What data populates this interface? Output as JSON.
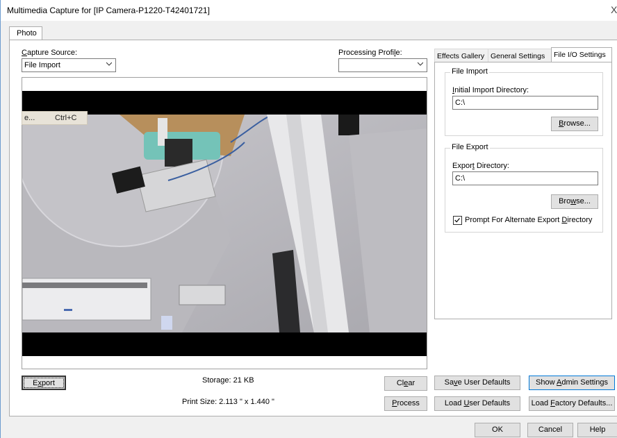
{
  "window": {
    "title": "Multimedia Capture for [IP Camera-P1220-T42401721]",
    "close_glyph": "X"
  },
  "tabs": {
    "photo": "Photo"
  },
  "capture_source": {
    "label_underlined": "C",
    "label_rest": "apture Source:",
    "value": "File Import"
  },
  "processing_profile": {
    "label_pre": "Processing Profi",
    "label_underlined": "l",
    "label_post": "e:",
    "value": ""
  },
  "context_menu": {
    "item_label": "e...",
    "shortcut": "Ctrl+C"
  },
  "bottom_bar": {
    "export_pre": "E",
    "export_underlined": "x",
    "export_post": "port",
    "storage": "Storage: 21 KB",
    "print_size": "Print Size: 2.113 \" x 1.440 \"",
    "clear_pre": "Cl",
    "clear_underlined": "e",
    "clear_post": "ar",
    "process_underlined": "P",
    "process_post": "rocess"
  },
  "settings_tabs": {
    "effects": "Effects Gallery",
    "general": "General Settings",
    "fileio": "File I/O Settings"
  },
  "file_import": {
    "group_title": "File Import",
    "dir_label_underlined": "I",
    "dir_label_rest": "nitial Import Directory:",
    "dir_value": "C:\\",
    "browse_underlined": "B",
    "browse_rest": "rowse..."
  },
  "file_export": {
    "group_title": "File Export",
    "dir_label_pre": "Expor",
    "dir_label_underlined": "t",
    "dir_label_post": " Directory:",
    "dir_value": "C:\\",
    "browse_pre": "Bro",
    "browse_underlined": "w",
    "browse_post": "se...",
    "prompt_pre": "Prompt For Alternate Export ",
    "prompt_underlined": "D",
    "prompt_post": "irectory",
    "prompt_checked": true
  },
  "defaults": {
    "save_pre": "Sa",
    "save_underlined": "v",
    "save_post": "e User Defaults",
    "show_admin_pre": "Show ",
    "show_admin_underlined": "A",
    "show_admin_post": "dmin Settings",
    "load_user_pre": "Load ",
    "load_user_underlined": "U",
    "load_user_post": "ser Defaults",
    "load_factory_pre": "Load ",
    "load_factory_underlined": "F",
    "load_factory_post": "actory Defaults..."
  },
  "dialog_buttons": {
    "ok": "OK",
    "cancel": "Cancel",
    "help": "Help"
  },
  "colors": {
    "accent": "#0078d7",
    "window_border": "#6d9ccf",
    "dialog_bg": "#f0f0f0"
  }
}
